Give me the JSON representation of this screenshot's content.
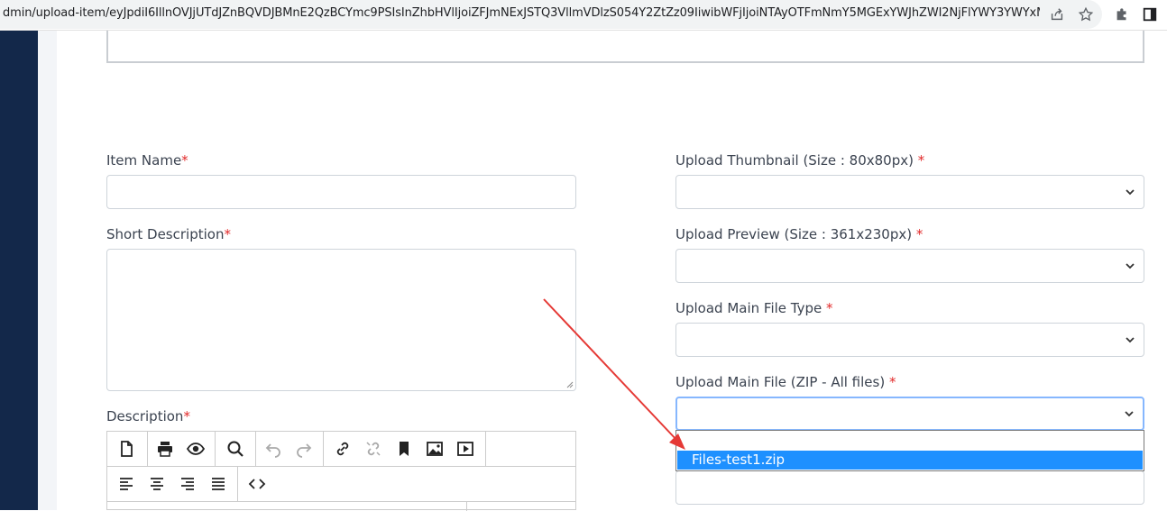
{
  "browser": {
    "url": "dmin/upload-item/eyJpdiI6IllnOVJjUTdJZnBQVDJBMnE2QzBCYmc9PSIsInZhbHVlIjoiZFJmNExJSTQ3VllmVDlzS054Y2ZtZz09IiwibWFjIjoiNTAyOTFmNmY5MGExYWJhZWI2NjFlYWY3YWYxMD..."
  },
  "form": {
    "item_name_label": "Item Name",
    "short_desc_label": "Short Description",
    "description_label": "Description",
    "thumbnail_label": "Upload Thumbnail (Size : 80x80px) ",
    "preview_label": "Upload Preview (Size : 361x230px) ",
    "main_type_label": "Upload Main File Type ",
    "main_file_label": "Upload Main File (ZIP - All files) ",
    "required_mark": "*"
  },
  "dropdown": {
    "selected_option": "Files-test1.zip"
  },
  "colors": {
    "sidebar": "#13284a",
    "required": "#e22a2a",
    "highlight": "#1e90ff",
    "arrow": "#e53935"
  }
}
